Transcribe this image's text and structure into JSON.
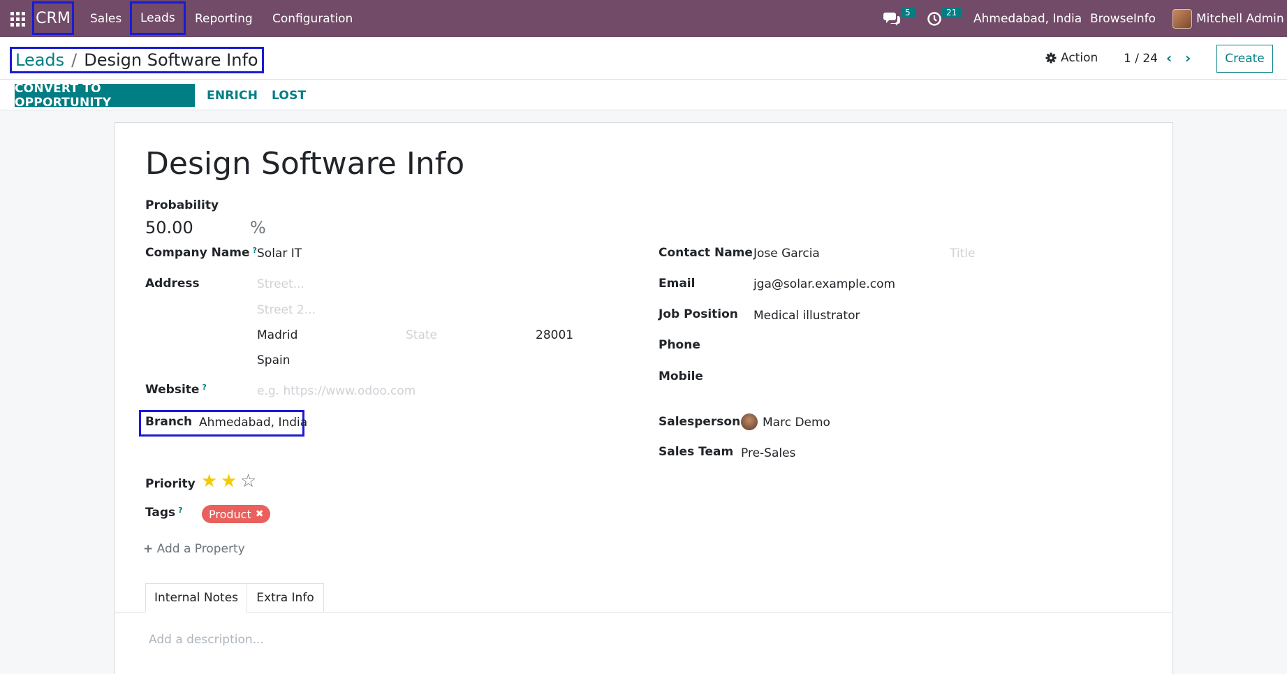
{
  "navbar": {
    "app_name": "CRM",
    "menu": [
      "Sales",
      "Leads",
      "Reporting",
      "Configuration"
    ],
    "messages_count": "5",
    "activities_count": "21",
    "branch": "Ahmedabad, India",
    "company": "BrowseInfo",
    "user": "Mitchell Admin"
  },
  "control_panel": {
    "breadcrumb_parent": "Leads",
    "breadcrumb_separator": "/",
    "breadcrumb_current": "Design Software Info",
    "action_label": "Action",
    "pager": "1 / 24",
    "create_label": "Create",
    "status_buttons": [
      "CONVERT TO OPPORTUNITY",
      "ENRICH",
      "LOST"
    ]
  },
  "form": {
    "title": "Design Software Info",
    "probability": {
      "label": "Probability",
      "value": "50.00",
      "unit": "%"
    },
    "company_name": {
      "label": "Company Name",
      "value": "Solar IT",
      "help": "?"
    },
    "address": {
      "label": "Address",
      "street_placeholder": "Street...",
      "street2_placeholder": "Street 2...",
      "city": "Madrid",
      "state_placeholder": "State",
      "zip": "28001",
      "country": "Spain"
    },
    "website": {
      "label": "Website",
      "placeholder": "e.g. https://www.odoo.com",
      "help": "?"
    },
    "branch": {
      "label": "Branch",
      "value": "Ahmedabad, India"
    },
    "priority": {
      "label": "Priority",
      "stars_filled": 2,
      "stars_total": 3
    },
    "tags": {
      "label": "Tags",
      "help": "?",
      "items": [
        "Product"
      ]
    },
    "add_property": "Add a Property",
    "contact_name": {
      "label": "Contact Name",
      "value": "Jose Garcia",
      "title_placeholder": "Title"
    },
    "email": {
      "label": "Email",
      "value": "jga@solar.example.com"
    },
    "job_position": {
      "label": "Job Position",
      "value": "Medical illustrator"
    },
    "phone": {
      "label": "Phone",
      "value": ""
    },
    "mobile": {
      "label": "Mobile",
      "value": ""
    },
    "salesperson": {
      "label": "Salesperson",
      "value": "Marc Demo"
    },
    "sales_team": {
      "label": "Sales Team",
      "value": "Pre-Sales"
    },
    "tabs": [
      "Internal Notes",
      "Extra Info"
    ],
    "description_placeholder": "Add a description..."
  },
  "colors": {
    "navbar": "#714b67",
    "accent": "#017e84",
    "highlight_box": "#1a1ad6",
    "tag": "#e9605c",
    "star": "#f3cc00"
  }
}
